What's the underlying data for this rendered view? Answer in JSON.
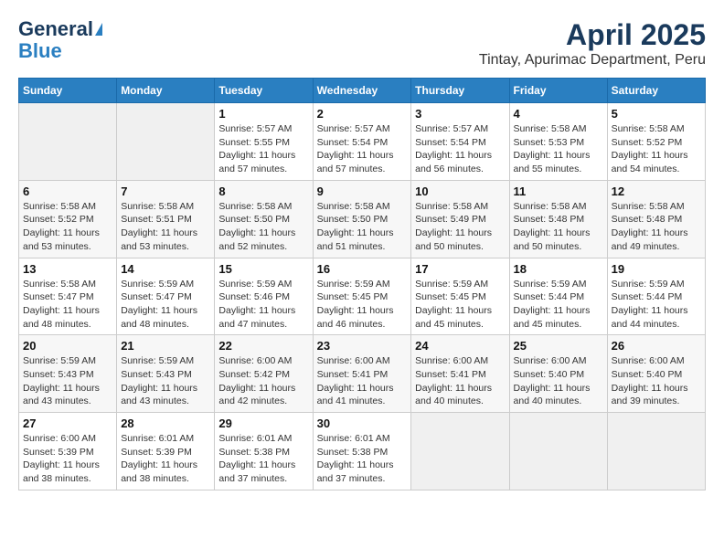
{
  "header": {
    "logo_line1": "General",
    "logo_line2": "Blue",
    "title": "April 2025",
    "subtitle": "Tintay, Apurimac Department, Peru"
  },
  "weekdays": [
    "Sunday",
    "Monday",
    "Tuesday",
    "Wednesday",
    "Thursday",
    "Friday",
    "Saturday"
  ],
  "weeks": [
    [
      {
        "day": "",
        "info": ""
      },
      {
        "day": "",
        "info": ""
      },
      {
        "day": "1",
        "info": "Sunrise: 5:57 AM\nSunset: 5:55 PM\nDaylight: 11 hours and 57 minutes."
      },
      {
        "day": "2",
        "info": "Sunrise: 5:57 AM\nSunset: 5:54 PM\nDaylight: 11 hours and 57 minutes."
      },
      {
        "day": "3",
        "info": "Sunrise: 5:57 AM\nSunset: 5:54 PM\nDaylight: 11 hours and 56 minutes."
      },
      {
        "day": "4",
        "info": "Sunrise: 5:58 AM\nSunset: 5:53 PM\nDaylight: 11 hours and 55 minutes."
      },
      {
        "day": "5",
        "info": "Sunrise: 5:58 AM\nSunset: 5:52 PM\nDaylight: 11 hours and 54 minutes."
      }
    ],
    [
      {
        "day": "6",
        "info": "Sunrise: 5:58 AM\nSunset: 5:52 PM\nDaylight: 11 hours and 53 minutes."
      },
      {
        "day": "7",
        "info": "Sunrise: 5:58 AM\nSunset: 5:51 PM\nDaylight: 11 hours and 53 minutes."
      },
      {
        "day": "8",
        "info": "Sunrise: 5:58 AM\nSunset: 5:50 PM\nDaylight: 11 hours and 52 minutes."
      },
      {
        "day": "9",
        "info": "Sunrise: 5:58 AM\nSunset: 5:50 PM\nDaylight: 11 hours and 51 minutes."
      },
      {
        "day": "10",
        "info": "Sunrise: 5:58 AM\nSunset: 5:49 PM\nDaylight: 11 hours and 50 minutes."
      },
      {
        "day": "11",
        "info": "Sunrise: 5:58 AM\nSunset: 5:48 PM\nDaylight: 11 hours and 50 minutes."
      },
      {
        "day": "12",
        "info": "Sunrise: 5:58 AM\nSunset: 5:48 PM\nDaylight: 11 hours and 49 minutes."
      }
    ],
    [
      {
        "day": "13",
        "info": "Sunrise: 5:58 AM\nSunset: 5:47 PM\nDaylight: 11 hours and 48 minutes."
      },
      {
        "day": "14",
        "info": "Sunrise: 5:59 AM\nSunset: 5:47 PM\nDaylight: 11 hours and 48 minutes."
      },
      {
        "day": "15",
        "info": "Sunrise: 5:59 AM\nSunset: 5:46 PM\nDaylight: 11 hours and 47 minutes."
      },
      {
        "day": "16",
        "info": "Sunrise: 5:59 AM\nSunset: 5:45 PM\nDaylight: 11 hours and 46 minutes."
      },
      {
        "day": "17",
        "info": "Sunrise: 5:59 AM\nSunset: 5:45 PM\nDaylight: 11 hours and 45 minutes."
      },
      {
        "day": "18",
        "info": "Sunrise: 5:59 AM\nSunset: 5:44 PM\nDaylight: 11 hours and 45 minutes."
      },
      {
        "day": "19",
        "info": "Sunrise: 5:59 AM\nSunset: 5:44 PM\nDaylight: 11 hours and 44 minutes."
      }
    ],
    [
      {
        "day": "20",
        "info": "Sunrise: 5:59 AM\nSunset: 5:43 PM\nDaylight: 11 hours and 43 minutes."
      },
      {
        "day": "21",
        "info": "Sunrise: 5:59 AM\nSunset: 5:43 PM\nDaylight: 11 hours and 43 minutes."
      },
      {
        "day": "22",
        "info": "Sunrise: 6:00 AM\nSunset: 5:42 PM\nDaylight: 11 hours and 42 minutes."
      },
      {
        "day": "23",
        "info": "Sunrise: 6:00 AM\nSunset: 5:41 PM\nDaylight: 11 hours and 41 minutes."
      },
      {
        "day": "24",
        "info": "Sunrise: 6:00 AM\nSunset: 5:41 PM\nDaylight: 11 hours and 40 minutes."
      },
      {
        "day": "25",
        "info": "Sunrise: 6:00 AM\nSunset: 5:40 PM\nDaylight: 11 hours and 40 minutes."
      },
      {
        "day": "26",
        "info": "Sunrise: 6:00 AM\nSunset: 5:40 PM\nDaylight: 11 hours and 39 minutes."
      }
    ],
    [
      {
        "day": "27",
        "info": "Sunrise: 6:00 AM\nSunset: 5:39 PM\nDaylight: 11 hours and 38 minutes."
      },
      {
        "day": "28",
        "info": "Sunrise: 6:01 AM\nSunset: 5:39 PM\nDaylight: 11 hours and 38 minutes."
      },
      {
        "day": "29",
        "info": "Sunrise: 6:01 AM\nSunset: 5:38 PM\nDaylight: 11 hours and 37 minutes."
      },
      {
        "day": "30",
        "info": "Sunrise: 6:01 AM\nSunset: 5:38 PM\nDaylight: 11 hours and 37 minutes."
      },
      {
        "day": "",
        "info": ""
      },
      {
        "day": "",
        "info": ""
      },
      {
        "day": "",
        "info": ""
      }
    ]
  ]
}
